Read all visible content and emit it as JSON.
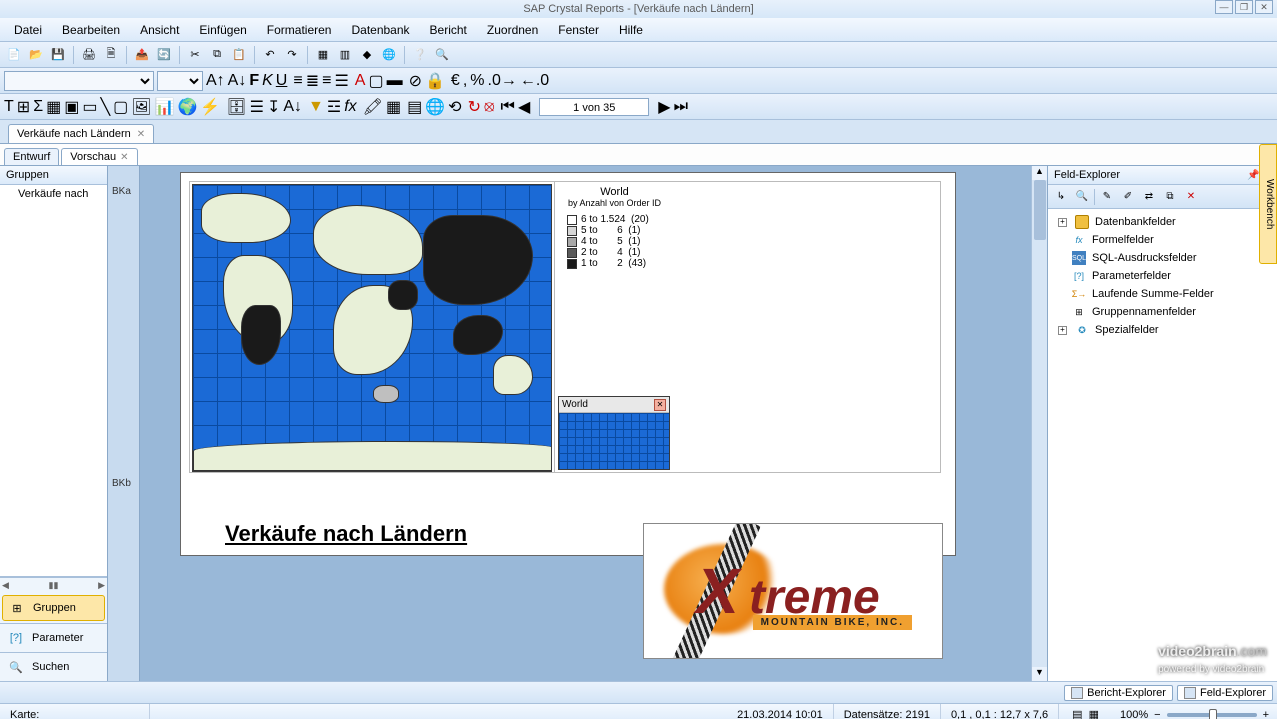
{
  "app": {
    "title": "SAP Crystal Reports - [Verkäufe nach Ländern]"
  },
  "menu": {
    "file": "Datei",
    "edit": "Bearbeiten",
    "view": "Ansicht",
    "insert": "Einfügen",
    "format": "Formatieren",
    "database": "Datenbank",
    "report": "Bericht",
    "arrange": "Zuordnen",
    "window": "Fenster",
    "help": "Hilfe"
  },
  "nav": {
    "page": "1 von 35"
  },
  "doctab": {
    "label": "Verkäufe nach Ländern"
  },
  "viewtabs": {
    "design": "Entwurf",
    "preview": "Vorschau"
  },
  "left": {
    "head": "Gruppen",
    "node": "Verkäufe nach",
    "btn_groups": "Gruppen",
    "btn_params": "Parameter",
    "btn_search": "Suchen"
  },
  "sections": {
    "top": "BKa",
    "bottom": "BKb"
  },
  "map": {
    "legend_title": "World",
    "legend_sub": "by Anzahl von Order ID",
    "rows": [
      {
        "label": "6 to 1.524",
        "count": "(20)",
        "color": "#ffffff"
      },
      {
        "label": "5 to       6",
        "count": "(1)",
        "color": "#d6d6d6"
      },
      {
        "label": "4 to       5",
        "count": "(1)",
        "color": "#a8a8a8"
      },
      {
        "label": "2 to       4",
        "count": "(1)",
        "color": "#5a5a5a"
      },
      {
        "label": "1 to       2",
        "count": "(43)",
        "color": "#1a1a1a"
      }
    ],
    "mini_title": "World"
  },
  "report": {
    "title": "Verkäufe nach Ländern",
    "logo_text": "treme",
    "logo_sub": "MOUNTAIN BIKE, INC."
  },
  "right": {
    "head": "Feld-Explorer",
    "items": {
      "db": "Datenbankfelder",
      "formula": "Formelfelder",
      "sql": "SQL-Ausdrucksfelder",
      "param": "Parameterfelder",
      "running": "Laufende Summe-Felder",
      "group": "Gruppennamenfelder",
      "special": "Spezialfelder"
    }
  },
  "workbench": "Workbench",
  "bottom": {
    "tab1": "Bericht-Explorer",
    "tab2": "Feld-Explorer"
  },
  "status": {
    "karte": "Karte:",
    "datetime": "21.03.2014  10:01",
    "records": "Datensätze: 2191",
    "coords": "0,1 , 0,1 : 12,7 x 7,6",
    "zoom": "100%"
  },
  "watermark": {
    "brand": "video2brain",
    "dom": ".com",
    "sub": "powered by video2brain"
  }
}
